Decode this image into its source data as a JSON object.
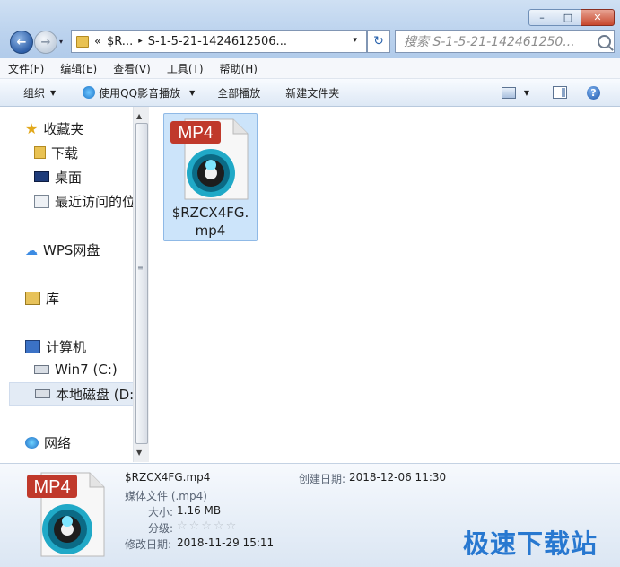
{
  "window": {
    "minimize": "–",
    "maximize": "□",
    "close": "✕"
  },
  "nav": {
    "back_icon": "back-arrow-icon",
    "forward_icon": "forward-arrow-icon"
  },
  "address": {
    "overflow": "«",
    "crumb1": "$R...",
    "sep": "▸",
    "crumb2": "S-1-5-21-1424612506...",
    "dropdown": "▾"
  },
  "refresh_icon": "refresh-icon",
  "search": {
    "placeholder": "搜索 S-1-5-21-142461250..."
  },
  "menu": [
    "文件(F)",
    "编辑(E)",
    "查看(V)",
    "工具(T)",
    "帮助(H)"
  ],
  "toolbar": {
    "organize": "组织",
    "play_qq": "使用QQ影音播放",
    "play_all": "全部播放",
    "new_folder": "新建文件夹",
    "arrow": "▼",
    "help": "?"
  },
  "navpane": {
    "favorites": "收藏夹",
    "downloads": "下载",
    "desktop": "桌面",
    "recent": "最近访问的位",
    "wps": "WPS网盘",
    "libraries": "库",
    "computer": "计算机",
    "win7": "Win7 (C:)",
    "local_disk": "本地磁盘 (D:",
    "network": "网络"
  },
  "scrollbar": {
    "up": "▲",
    "down": "▼",
    "grip": "≡"
  },
  "file": {
    "badge": "MP4",
    "name_line1": "$RZCX4FG.",
    "name_line2": "mp4"
  },
  "details": {
    "badge": "MP4",
    "filename": "$RZCX4FG.mp4",
    "type": "媒体文件 (.mp4)",
    "size_label": "大小:",
    "size_value": "1.16 MB",
    "rating_label": "分级:",
    "rating_stars": "☆☆☆☆☆",
    "rating_value": 0,
    "modified_label": "修改日期:",
    "modified_value": "2018-11-29 15:11",
    "created_label": "创建日期:",
    "created_value": "2018-12-06 11:30"
  },
  "watermark": "极速下载站"
}
